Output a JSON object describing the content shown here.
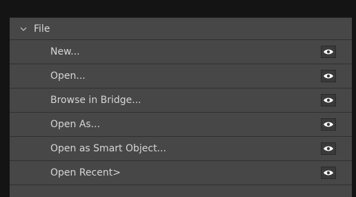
{
  "section": {
    "title": "File",
    "expanded_icon": "chevron-down-icon"
  },
  "items": [
    {
      "label": "New...",
      "visibility_icon": "eye-icon"
    },
    {
      "label": "Open...",
      "visibility_icon": "eye-icon"
    },
    {
      "label": "Browse in Bridge...",
      "visibility_icon": "eye-icon"
    },
    {
      "label": "Open As...",
      "visibility_icon": "eye-icon"
    },
    {
      "label": "Open as Smart Object...",
      "visibility_icon": "eye-icon"
    },
    {
      "label": "Open Recent>",
      "visibility_icon": "eye-icon"
    }
  ],
  "colors": {
    "panel_bg": "#474747",
    "text": "#d6d6d6",
    "divider": "#2f2f2f"
  }
}
